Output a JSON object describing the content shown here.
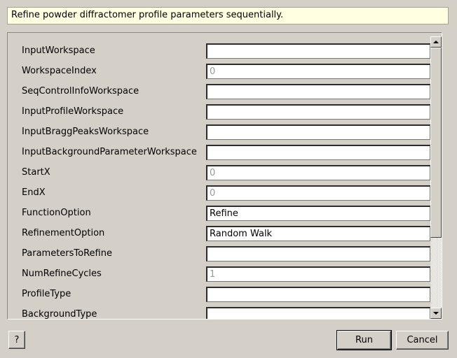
{
  "description": "Refine powder diffractomer profile parameters sequentially.",
  "properties": [
    {
      "label": "InputWorkspace",
      "value": "",
      "is_default": false
    },
    {
      "label": "WorkspaceIndex",
      "value": "0",
      "is_default": true
    },
    {
      "label": "SeqControlInfoWorkspace",
      "value": "",
      "is_default": false
    },
    {
      "label": "InputProfileWorkspace",
      "value": "",
      "is_default": false
    },
    {
      "label": "InputBraggPeaksWorkspace",
      "value": "",
      "is_default": false
    },
    {
      "label": "InputBackgroundParameterWorkspace",
      "value": "",
      "is_default": false
    },
    {
      "label": "StartX",
      "value": "0",
      "is_default": true
    },
    {
      "label": "EndX",
      "value": "0",
      "is_default": true
    },
    {
      "label": "FunctionOption",
      "value": "Refine",
      "is_default": false
    },
    {
      "label": "RefinementOption",
      "value": "Random Walk",
      "is_default": false
    },
    {
      "label": "ParametersToRefine",
      "value": "",
      "is_default": false
    },
    {
      "label": "NumRefineCycles",
      "value": "1",
      "is_default": true
    },
    {
      "label": "ProfileType",
      "value": "",
      "is_default": false
    },
    {
      "label": "BackgroundType",
      "value": "",
      "is_default": false
    }
  ],
  "buttons": {
    "help": "?",
    "run": "Run",
    "cancel": "Cancel"
  },
  "scrollbar": {
    "up_icon": "arrow-up-icon",
    "down_icon": "arrow-down-icon"
  }
}
